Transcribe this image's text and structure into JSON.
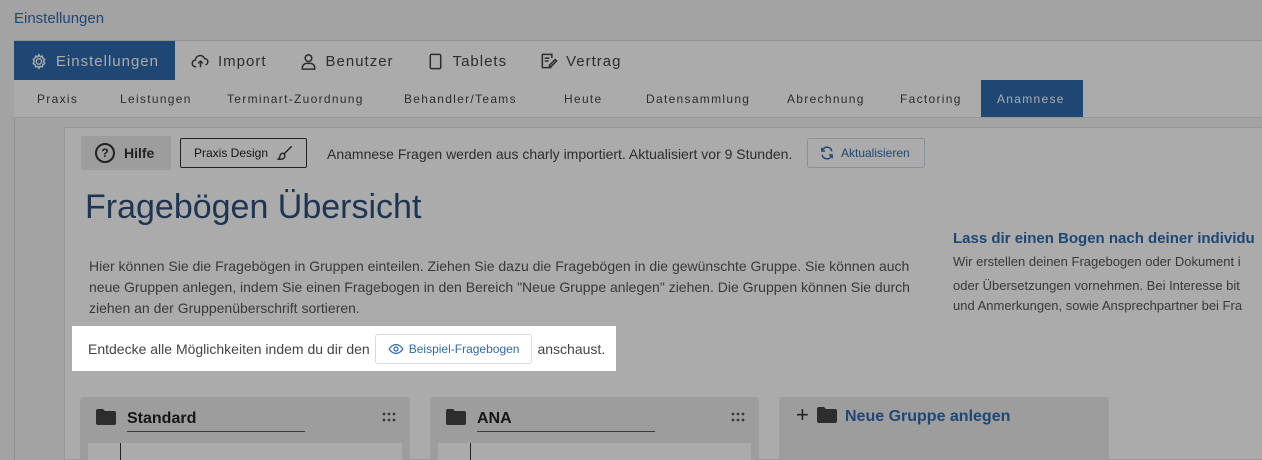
{
  "page_title": "Einstellungen",
  "main_tabs": [
    {
      "label": "Einstellungen",
      "icon": "gear-icon",
      "active": true
    },
    {
      "label": "Import",
      "icon": "cloud-upload-icon"
    },
    {
      "label": "Benutzer",
      "icon": "user-icon"
    },
    {
      "label": "Tablets",
      "icon": "tablet-icon"
    },
    {
      "label": "Vertrag",
      "icon": "contract-icon"
    }
  ],
  "sub_tabs": [
    {
      "label": "Praxis"
    },
    {
      "label": "Leistungen"
    },
    {
      "label": "Terminart-Zuordnung"
    },
    {
      "label": "Behandler/Teams"
    },
    {
      "label": "Heute"
    },
    {
      "label": "Datensammlung"
    },
    {
      "label": "Abrechnung"
    },
    {
      "label": "Factoring"
    },
    {
      "label": "Anamnese",
      "active": true
    }
  ],
  "toolbar": {
    "help_label": "Hilfe",
    "help_icon": "?",
    "design_label": "Praxis Design",
    "import_info": "Anamnese Fragen werden aus charly importiert. Aktualisiert vor 9 Stunden.",
    "refresh_label": "Aktualisieren"
  },
  "main": {
    "title": "Fragebögen Übersicht",
    "description": "Hier können Sie die Fragebögen in Gruppen einteilen. Ziehen Sie dazu die Fragebögen in die gewünschte Gruppe. Sie können auch neue Gruppen anlegen, indem Sie einen Fragebogen in den Bereich \"Neue Gruppe anlegen\" ziehen. Die Gruppen können Sie durch ziehen an der Gruppenüberschrift sortieren."
  },
  "promo": {
    "title": "Lass dir einen Bogen nach deiner individu",
    "lines": [
      "Wir erstellen deinen Fragebogen oder Dokument i",
      "oder Übersetzungen vornehmen. Bei Interesse bit",
      "und Anmerkungen, sowie Ansprechpartner bei Fra"
    ]
  },
  "spotlight": {
    "text_before": "Entdecke alle Möglichkeiten indem du dir den",
    "button_label": "Beispiel-Fragebogen",
    "text_after": "anschaust."
  },
  "groups": [
    {
      "name": "Standard"
    },
    {
      "name": "ANA"
    }
  ],
  "new_group": {
    "plus": "+",
    "label": "Neue Gruppe anlegen"
  },
  "colors": {
    "accent": "#2f6aad",
    "title": "#2c4f7c",
    "overlay": "rgba(0,0,0,0.33)"
  }
}
